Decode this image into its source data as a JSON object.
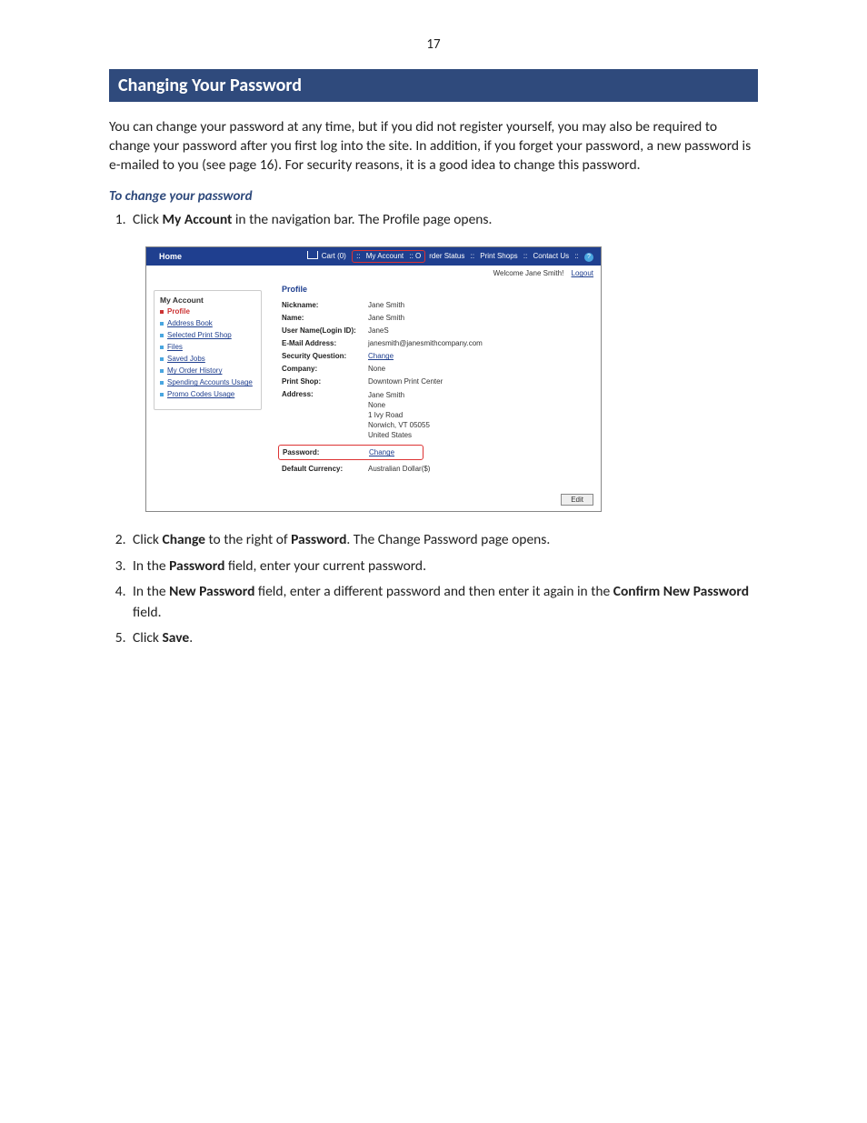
{
  "page_number": "17",
  "heading": "Changing Your Password",
  "intro": "You can change your password at any time, but if you did not register yourself, you may also be required to change your password after you first log into the site. In addition, if you forget your password, a new password is e-mailed to you (see page 16). For security reasons, it is a good idea to change this password.",
  "subhead": "To change your password",
  "steps": {
    "s1a": "Click ",
    "s1b": "My Account",
    "s1c": " in the navigation bar. The Profile page opens.",
    "s2a": "Click ",
    "s2b": "Change",
    "s2c": " to the right of ",
    "s2d": "Password",
    "s2e": ". The Change Password page opens.",
    "s3a": "In the ",
    "s3b": "Password",
    "s3c": " field, enter your current password.",
    "s4a": "In the ",
    "s4b": "New Password",
    "s4c": " field, enter a different password and then enter it again in the ",
    "s4d": "Confirm New Password",
    "s4e": " field.",
    "s5a": "Click ",
    "s5b": "Save",
    "s5c": "."
  },
  "shot": {
    "nav": {
      "home": "Home",
      "cart": "Cart (0)",
      "sep": " :: ",
      "my_account": "My Account",
      "order_status_left": " :: O",
      "order_status_right": "rder Status",
      "print_shops": "Print Shops",
      "contact": "Contact Us",
      "help": "?"
    },
    "welcome": "Welcome Jane Smith!",
    "logout": "Logout",
    "sidebar": {
      "title": "My Account",
      "items": [
        {
          "label": "Profile",
          "active": true
        },
        {
          "label": "Address Book",
          "active": false
        },
        {
          "label": "Selected Print Shop",
          "active": false
        },
        {
          "label": "Files",
          "active": false
        },
        {
          "label": "Saved Jobs",
          "active": false
        },
        {
          "label": "My Order History",
          "active": false
        },
        {
          "label": "Spending Accounts Usage",
          "active": false
        },
        {
          "label": "Promo Codes Usage",
          "active": false
        }
      ]
    },
    "profile": {
      "title": "Profile",
      "rows": {
        "nickname_l": "Nickname:",
        "nickname_v": "Jane Smith",
        "name_l": "Name:",
        "name_v": "Jane Smith",
        "login_l": "User Name(Login ID):",
        "login_v": "JaneS",
        "email_l": "E-Mail Address:",
        "email_v": "janesmith@janesmithcompany.com",
        "secq_l": "Security Question:",
        "secq_v": "Change",
        "company_l": "Company:",
        "company_v": "None",
        "shop_l": "Print Shop:",
        "shop_v": "Downtown Print Center",
        "addr_l": "Address:",
        "addr1": "Jane Smith",
        "addr2": "None",
        "addr3": "1 Ivy Road",
        "addr4": "Norwich, VT 05055",
        "addr5": "United States",
        "pwd_l": "Password:",
        "pwd_v": "Change",
        "curr_l": "Default Currency:",
        "curr_v": "Australian Dollar($)"
      },
      "edit": "Edit"
    }
  }
}
